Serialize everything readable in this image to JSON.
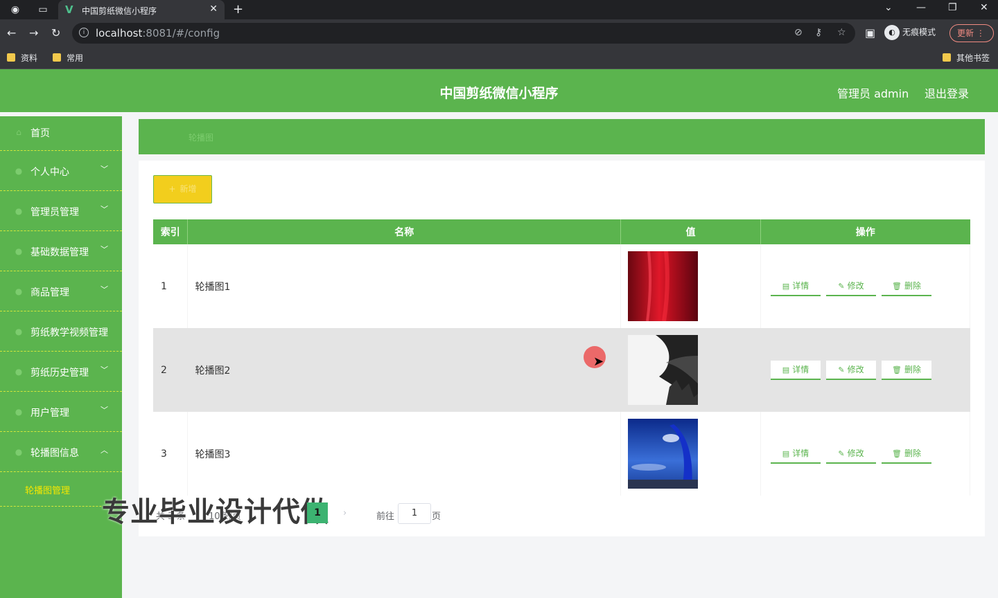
{
  "browser": {
    "tab_title": "中国剪纸微信小程序",
    "url_host": "localhost",
    "url_rest": ":8081/#/config",
    "incognito_label": "无痕模式",
    "update_label": "更新",
    "bookmarks": [
      "资料",
      "常用"
    ],
    "other_bookmarks": "其他书签"
  },
  "header": {
    "title": "中国剪纸微信小程序",
    "admin_label": "管理员 admin",
    "logout_label": "退出登录"
  },
  "sidebar": {
    "items": [
      {
        "label": "首页"
      },
      {
        "label": "个人中心"
      },
      {
        "label": "管理员管理"
      },
      {
        "label": "基础数据管理"
      },
      {
        "label": "商品管理"
      },
      {
        "label": "剪纸教学视频管理"
      },
      {
        "label": "剪纸历史管理"
      },
      {
        "label": "用户管理"
      },
      {
        "label": "轮播图信息"
      }
    ],
    "sub_item": "轮播图管理"
  },
  "breadcrumb": "轮播图",
  "add_button": "新增",
  "table": {
    "headers": [
      "索引",
      "名称",
      "值",
      "操作"
    ],
    "rows": [
      {
        "index": "1",
        "name": "轮播图1",
        "image": "red-curtain"
      },
      {
        "index": "2",
        "name": "轮播图2",
        "image": "ink-landscape"
      },
      {
        "index": "3",
        "name": "轮播图3",
        "image": "blue-sky-sculpture"
      }
    ],
    "actions": {
      "detail": "详情",
      "edit": "修改",
      "delete": "删除"
    }
  },
  "pagination": {
    "total": "共 3 条",
    "page_size": "10条/页",
    "current_page": "1",
    "goto_label": "前往",
    "goto_value": "1",
    "page_suffix": "页"
  },
  "watermark": "专业毕业设计代做"
}
